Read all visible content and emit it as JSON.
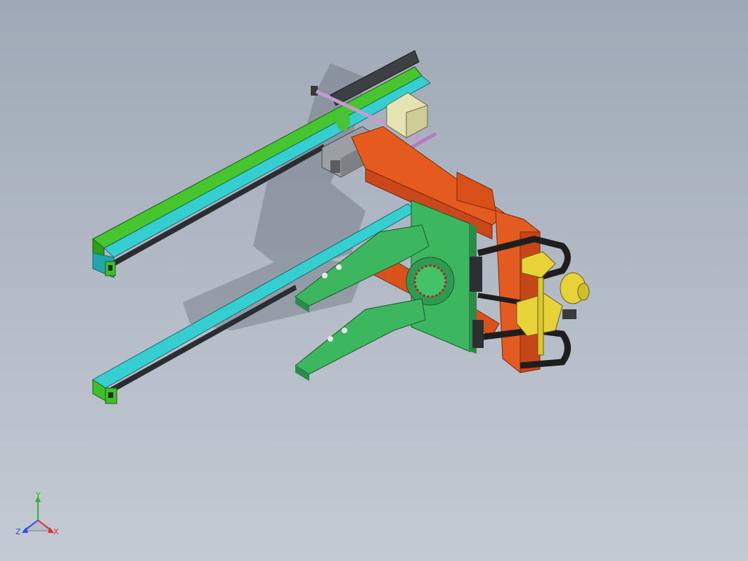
{
  "view": {
    "background_top": "#9fa8b6",
    "background_bottom": "#c4cad3"
  },
  "triad": {
    "x_label": "X",
    "y_label": "Y",
    "z_label": "Z",
    "x_color": "#e03030",
    "y_color": "#30b030",
    "z_color": "#3050e0"
  },
  "parts": [
    {
      "name": "rear-rail-green",
      "color": "#3fbf2a"
    },
    {
      "name": "rear-rail-cyan",
      "color": "#2fc6c9"
    },
    {
      "name": "front-rail-cyan",
      "color": "#2fc6c9"
    },
    {
      "name": "orange-frame",
      "color": "#e0561c"
    },
    {
      "name": "green-fork-gripper",
      "color": "#3aa65a"
    },
    {
      "name": "yellow-motor",
      "color": "#e8d23a"
    },
    {
      "name": "black-cable-chain",
      "color": "#1e1e1e"
    },
    {
      "name": "grey-carriage",
      "color": "#8e9296"
    },
    {
      "name": "pink-shaft",
      "color": "#c89ad2"
    },
    {
      "name": "cream-gearbox",
      "color": "#e6e3b2"
    }
  ]
}
